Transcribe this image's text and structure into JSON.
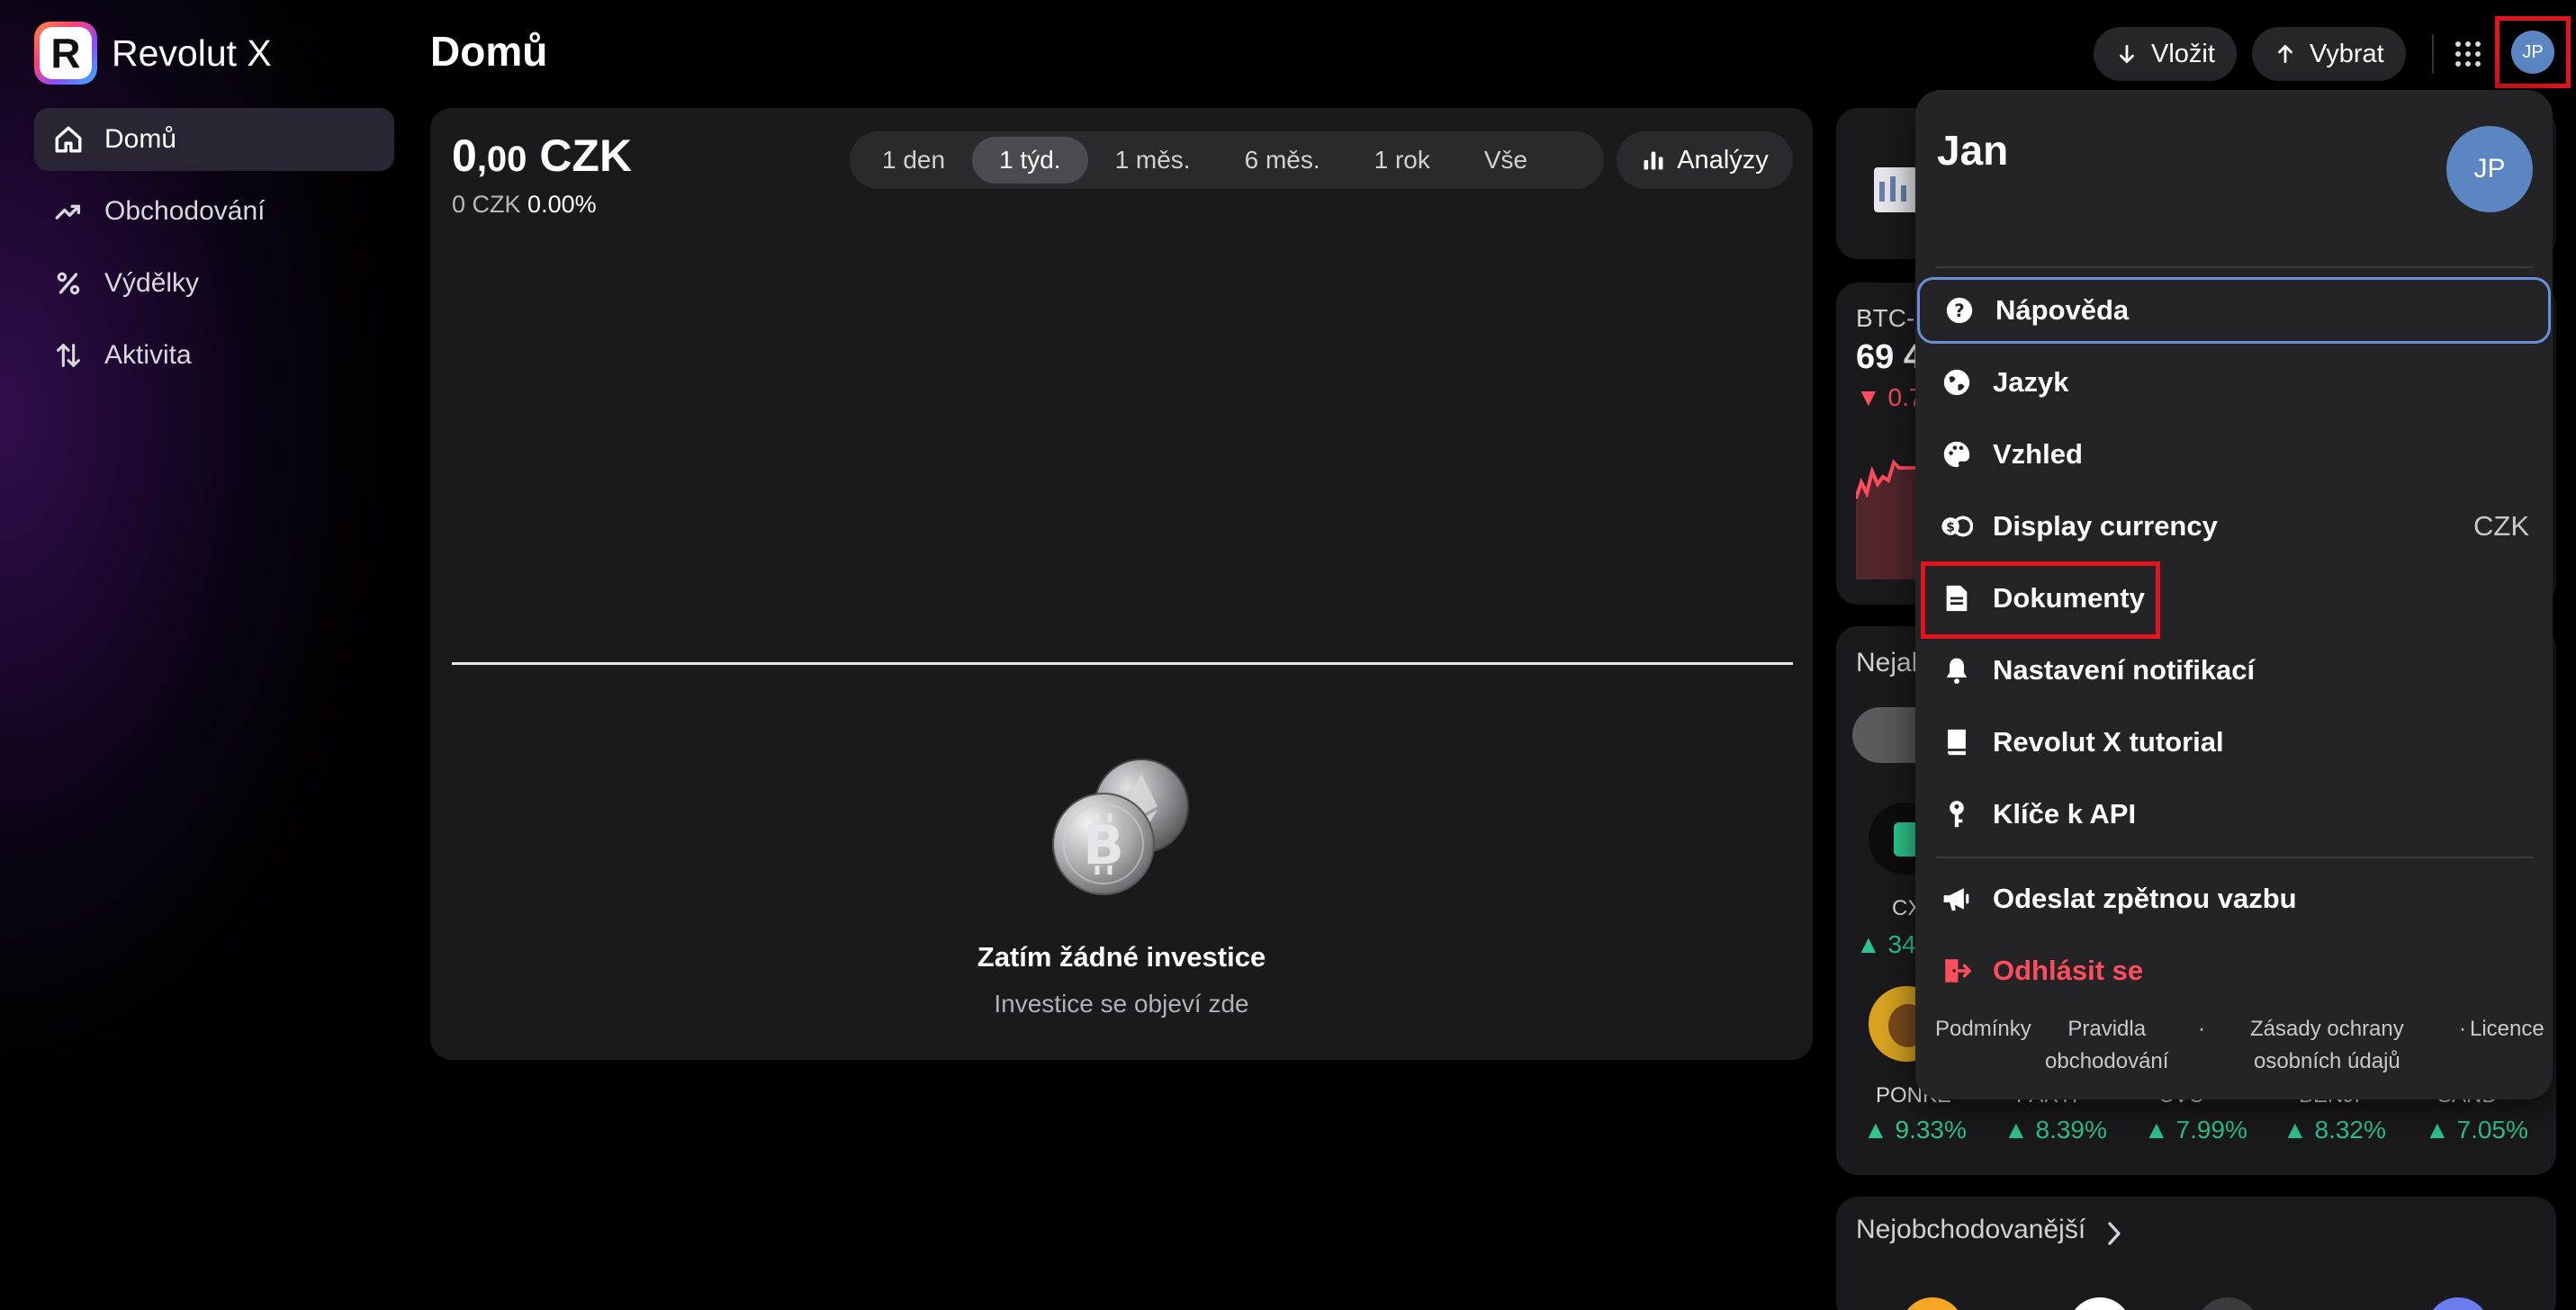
{
  "brand": {
    "logo_letter": "R",
    "name": "Revolut X"
  },
  "sidebar": {
    "items": [
      {
        "label": "Domů",
        "icon": "home-icon",
        "active": true
      },
      {
        "label": "Obchodování",
        "icon": "trend-up-icon",
        "active": false
      },
      {
        "label": "Výdělky",
        "icon": "percent-icon",
        "active": false
      },
      {
        "label": "Aktivita",
        "icon": "arrows-updown-icon",
        "active": false
      }
    ]
  },
  "header": {
    "title": "Domů",
    "deposit_label": "Vložit",
    "withdraw_label": "Vybrat",
    "avatar_initials": "JP"
  },
  "portfolio": {
    "balance_main": "0",
    "balance_decimals": ",00",
    "balance_currency": "CZK",
    "change_amount": "0 CZK",
    "change_percent": "0.00%",
    "ranges": [
      {
        "label": "1 den",
        "active": false
      },
      {
        "label": "1 týd.",
        "active": true
      },
      {
        "label": "1 měs.",
        "active": false
      },
      {
        "label": "6 měs.",
        "active": false
      },
      {
        "label": "1 rok",
        "active": false
      },
      {
        "label": "Vše",
        "active": false
      }
    ],
    "analytics_label": "Analýzy",
    "empty_title": "Zatím žádné investice",
    "empty_subtitle": "Investice se objeví zde"
  },
  "right_column": {
    "btc_label": "BTC-",
    "btc_price": "69 4",
    "btc_change": "▼ 0.7",
    "top_label": "Nejal",
    "coin_label_cx": "CX",
    "coin_pct_cx": "▲ 34.",
    "coin_ticks": [
      "PONKE",
      "PARTI",
      "CVC",
      "BENJI",
      "SAND"
    ],
    "coin_pcts": [
      "▲ 9.33%",
      "▲ 8.39%",
      "▲ 7.99%",
      "▲ 8.32%",
      "▲ 7.05%"
    ],
    "most_traded_label": "Nejobchodovanější"
  },
  "menu": {
    "user_name": "Jan",
    "avatar_initials": "JP",
    "items": [
      {
        "label": "Nápověda",
        "icon": "help-circle-icon"
      },
      {
        "label": "Jazyk",
        "icon": "globe-icon"
      },
      {
        "label": "Vzhled",
        "icon": "palette-icon"
      },
      {
        "label": "Display currency",
        "icon": "currency-exchange-icon",
        "value": "CZK"
      },
      {
        "label": "Dokumenty",
        "icon": "document-icon"
      },
      {
        "label": "Nastavení notifikací",
        "icon": "bell-icon"
      },
      {
        "label": "Revolut X tutorial",
        "icon": "book-icon"
      },
      {
        "label": "Klíče k API",
        "icon": "key-icon"
      },
      {
        "label": "Odeslat zpětnou vazbu",
        "icon": "megaphone-icon"
      },
      {
        "label": "Odhlásit se",
        "icon": "logout-icon"
      }
    ],
    "legal": {
      "terms": "Podmínky",
      "trading_rules_1": "Pravidla",
      "trading_rules_2": "obchodování",
      "privacy_1": "Zásady ochrany",
      "privacy_2": "osobních údajů",
      "licences": "Licence",
      "separator": "·"
    }
  },
  "colors": {
    "accent_red": "#e1151b",
    "positive": "#2fc58c",
    "negative": "#ff4d5e",
    "avatar": "#5b86c2"
  }
}
